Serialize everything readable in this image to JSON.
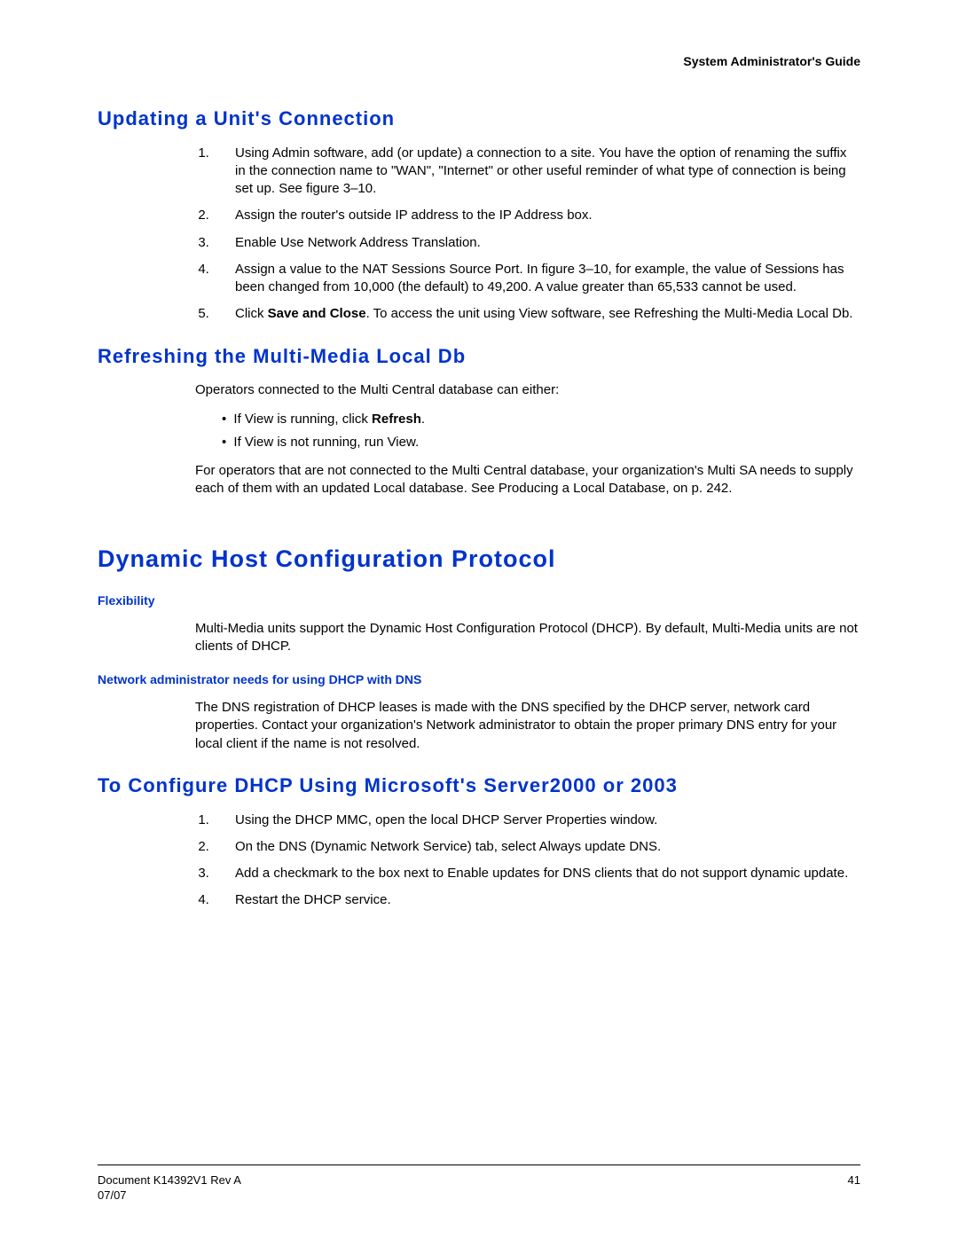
{
  "header": {
    "guide_title": "System Administrator's Guide"
  },
  "section1": {
    "title": "Updating a Unit's Connection",
    "items": [
      "Using Admin software, add (or update) a connection to a site. You have the option of renaming the suffix in the connection name to \"WAN\", \"Internet\" or other useful reminder of what type of connection is being set up. See figure 3–10.",
      "Assign the router's outside IP address to the IP Address box.",
      "Enable Use Network Address Translation.",
      "Assign a value to the NAT Sessions Source Port. In figure 3–10, for example, the value of Sessions has been changed from 10,000 (the default) to 49,200. A value greater than 65,533 cannot be used."
    ],
    "item5_pre": "Click ",
    "item5_bold": "Save and Close",
    "item5_post": ". To access the unit using View software, see Refreshing the Multi-Media Local Db."
  },
  "section2": {
    "title": "Refreshing the Multi-Media Local Db",
    "intro": "Operators connected to the Multi Central database can either:",
    "bullet1_pre": "If View is running, click ",
    "bullet1_bold": "Refresh",
    "bullet1_post": ".",
    "bullet2": "If View is not running, run View.",
    "outro": "For operators that are not connected to the Multi Central database, your organization's Multi SA needs to supply each of them with an updated Local database. See Producing a Local Database, on p. 242."
  },
  "section3": {
    "title": "Dynamic Host Configuration Protocol",
    "sub1": "Flexibility",
    "para1": "Multi-Media units support the Dynamic Host Configuration Protocol (DHCP). By default, Multi-Media units are not clients of DHCP.",
    "sub2": "Network administrator needs for using DHCP with DNS",
    "para2": "The DNS registration of DHCP leases is made with the DNS specified by the DHCP server, network card properties. Contact your organization's Network administrator to obtain the proper primary DNS entry for your local client if the name is not resolved."
  },
  "section4": {
    "title": "To Configure DHCP Using Microsoft's Server2000 or 2003",
    "items": [
      "Using the DHCP MMC, open the local DHCP Server Properties window.",
      "On the DNS (Dynamic Network Service) tab, select Always update DNS.",
      "Add a checkmark to the box next to Enable updates for DNS clients that do not support dynamic update.",
      "Restart the DHCP service."
    ]
  },
  "footer": {
    "doc_id": "Document K14392V1 Rev A",
    "date": "07/07",
    "page": "41"
  }
}
